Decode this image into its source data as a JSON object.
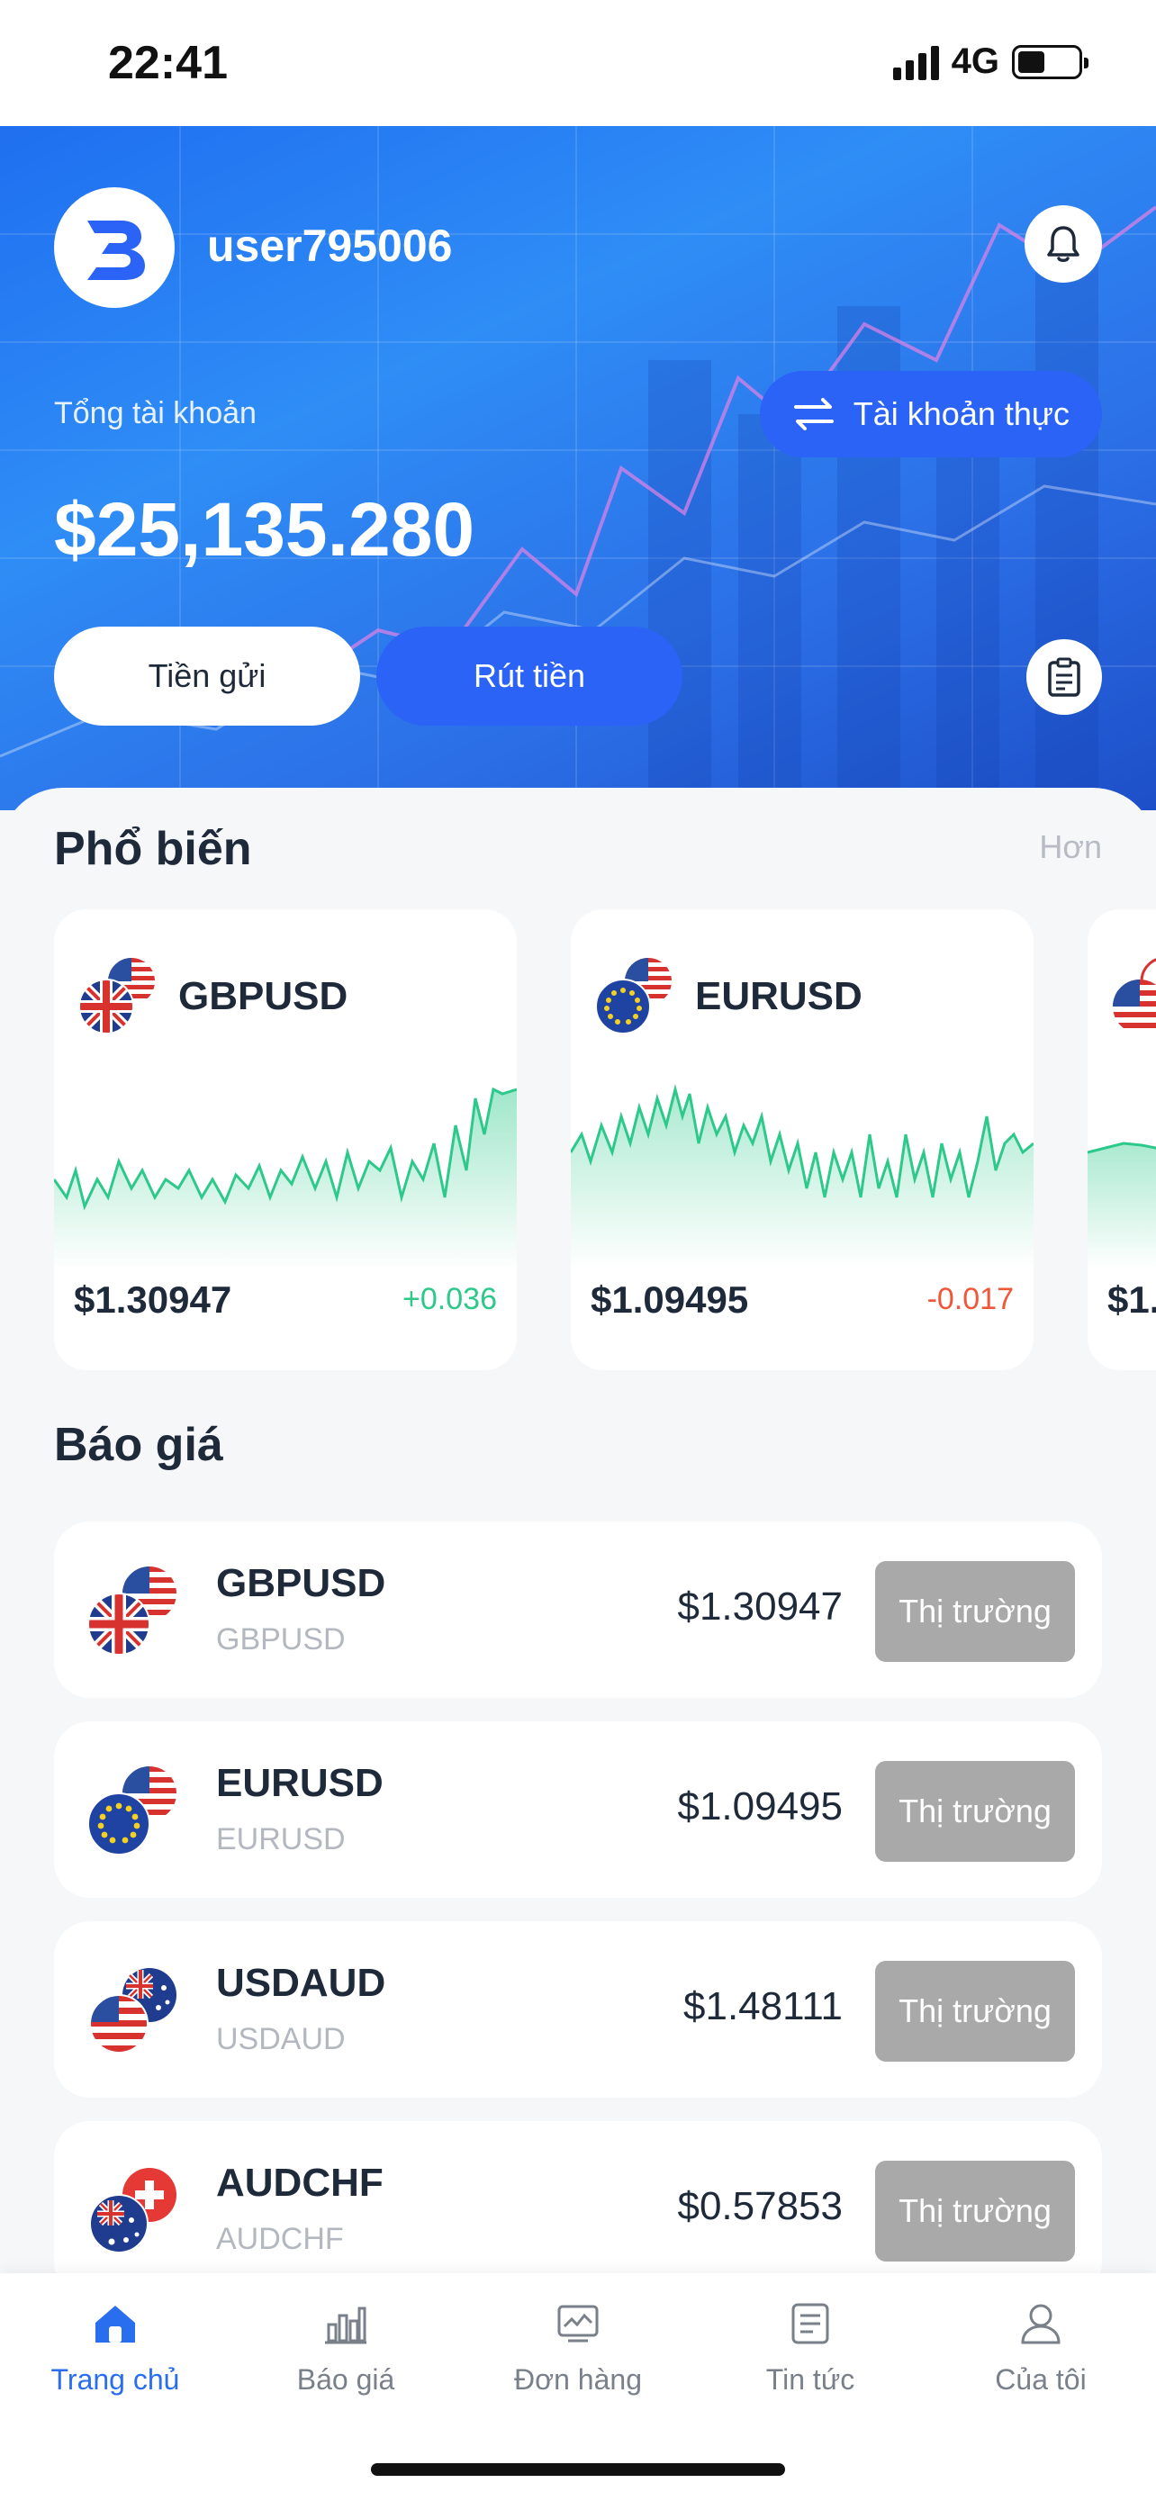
{
  "status_bar": {
    "time": "22:41",
    "network": "4G"
  },
  "header": {
    "username": "user795006",
    "total_label": "Tổng tài khoản",
    "account_type": "Tài khoản thực",
    "balance": "$25,135.280",
    "deposit_label": "Tiền gửi",
    "withdraw_label": "Rút tiền"
  },
  "popular": {
    "title": "Phổ biến",
    "more": "Hơn",
    "cards": [
      {
        "symbol": "GBPUSD",
        "price": "$1.30947",
        "change": "+0.036",
        "direction": "up",
        "flags": [
          "gb",
          "us"
        ]
      },
      {
        "symbol": "EURUSD",
        "price": "$1.09495",
        "change": "-0.017",
        "direction": "down",
        "flags": [
          "eu",
          "us"
        ]
      },
      {
        "symbol": "",
        "price": "$1.",
        "change": "",
        "direction": "up",
        "flags": [
          "us",
          "gb"
        ]
      }
    ]
  },
  "quotes": {
    "title": "Báo giá",
    "button_label": "Thị trường",
    "rows": [
      {
        "symbol": "GBPUSD",
        "sub": "GBPUSD",
        "price": "$1.30947",
        "flags": [
          "gb",
          "us"
        ]
      },
      {
        "symbol": "EURUSD",
        "sub": "EURUSD",
        "price": "$1.09495",
        "flags": [
          "eu",
          "us"
        ]
      },
      {
        "symbol": "USDAUD",
        "sub": "USDAUD",
        "price": "$1.48111",
        "flags": [
          "us",
          "au"
        ]
      },
      {
        "symbol": "AUDCHF",
        "sub": "AUDCHF",
        "price": "$0.57853",
        "flags": [
          "au",
          "ch"
        ]
      }
    ]
  },
  "nav": {
    "items": [
      {
        "label": "Trang chủ",
        "icon": "home-icon",
        "active": true
      },
      {
        "label": "Báo giá",
        "icon": "bar-chart-icon",
        "active": false
      },
      {
        "label": "Đơn hàng",
        "icon": "order-icon",
        "active": false
      },
      {
        "label": "Tin tức",
        "icon": "news-icon",
        "active": false
      },
      {
        "label": "Của tôi",
        "icon": "user-icon",
        "active": false
      }
    ]
  },
  "colors": {
    "accent": "#2a63f5",
    "up": "#2cc98b",
    "down": "#f0563a",
    "button_gray": "#a9a9a9"
  }
}
